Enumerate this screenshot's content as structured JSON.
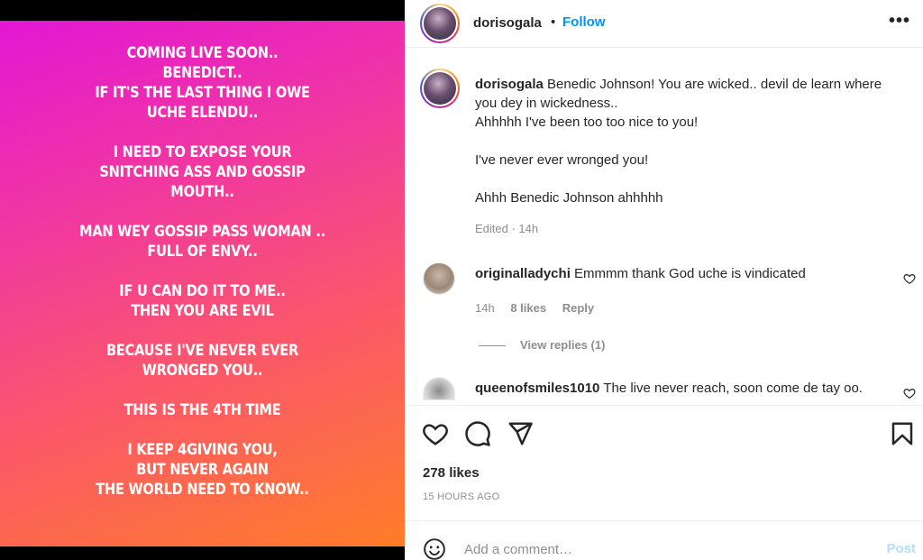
{
  "story": {
    "blocks": [
      [
        "COMING LIVE SOON..",
        "BENEDICT..",
        "IF IT'S THE LAST THING I OWE",
        "UCHE ELENDU.."
      ],
      [
        "I NEED TO EXPOSE YOUR",
        "SNITCHING ASS AND GOSSIP",
        "MOUTH.."
      ],
      [
        "MAN WEY GOSSIP PASS WOMAN ..",
        "FULL OF ENVY.."
      ],
      [
        "IF U CAN DO IT TO ME..",
        "THEN YOU ARE EVIL"
      ],
      [
        "BECAUSE I'VE NEVER EVER",
        "WRONGED YOU.."
      ],
      [
        "THIS IS THE 4TH TIME"
      ],
      [
        "I KEEP 4GIVING YOU,",
        "BUT NEVER AGAIN",
        "THE WORLD NEED TO KNOW.."
      ]
    ]
  },
  "header": {
    "username": "dorisogala",
    "separator": "•",
    "follow_label": "Follow",
    "more_label": "•••"
  },
  "caption": {
    "username": "dorisogala",
    "line1": "Benedic Johnson! You are wicked.. devil de learn where you dey in wickedness..",
    "line2": "Ahhhhh I've been too too nice to you!",
    "line3": "I've never ever wronged you!",
    "line4": "Ahhh Benedic Johnson ahhhhh",
    "meta": "Edited · 14h"
  },
  "comments": [
    {
      "username": "originalladychi",
      "text": "Emmmm thank God uche is vindicated",
      "time": "14h",
      "likes": "8 likes",
      "reply": "Reply",
      "view_replies": "View replies (1)"
    },
    {
      "username": "queenofsmiles1010",
      "text": "The live never reach, soon come de tay oo."
    }
  ],
  "actions": {
    "likes": "278 likes",
    "time": "15 HOURS AGO"
  },
  "add_comment": {
    "placeholder": "Add a comment…",
    "post_label": "Post"
  }
}
